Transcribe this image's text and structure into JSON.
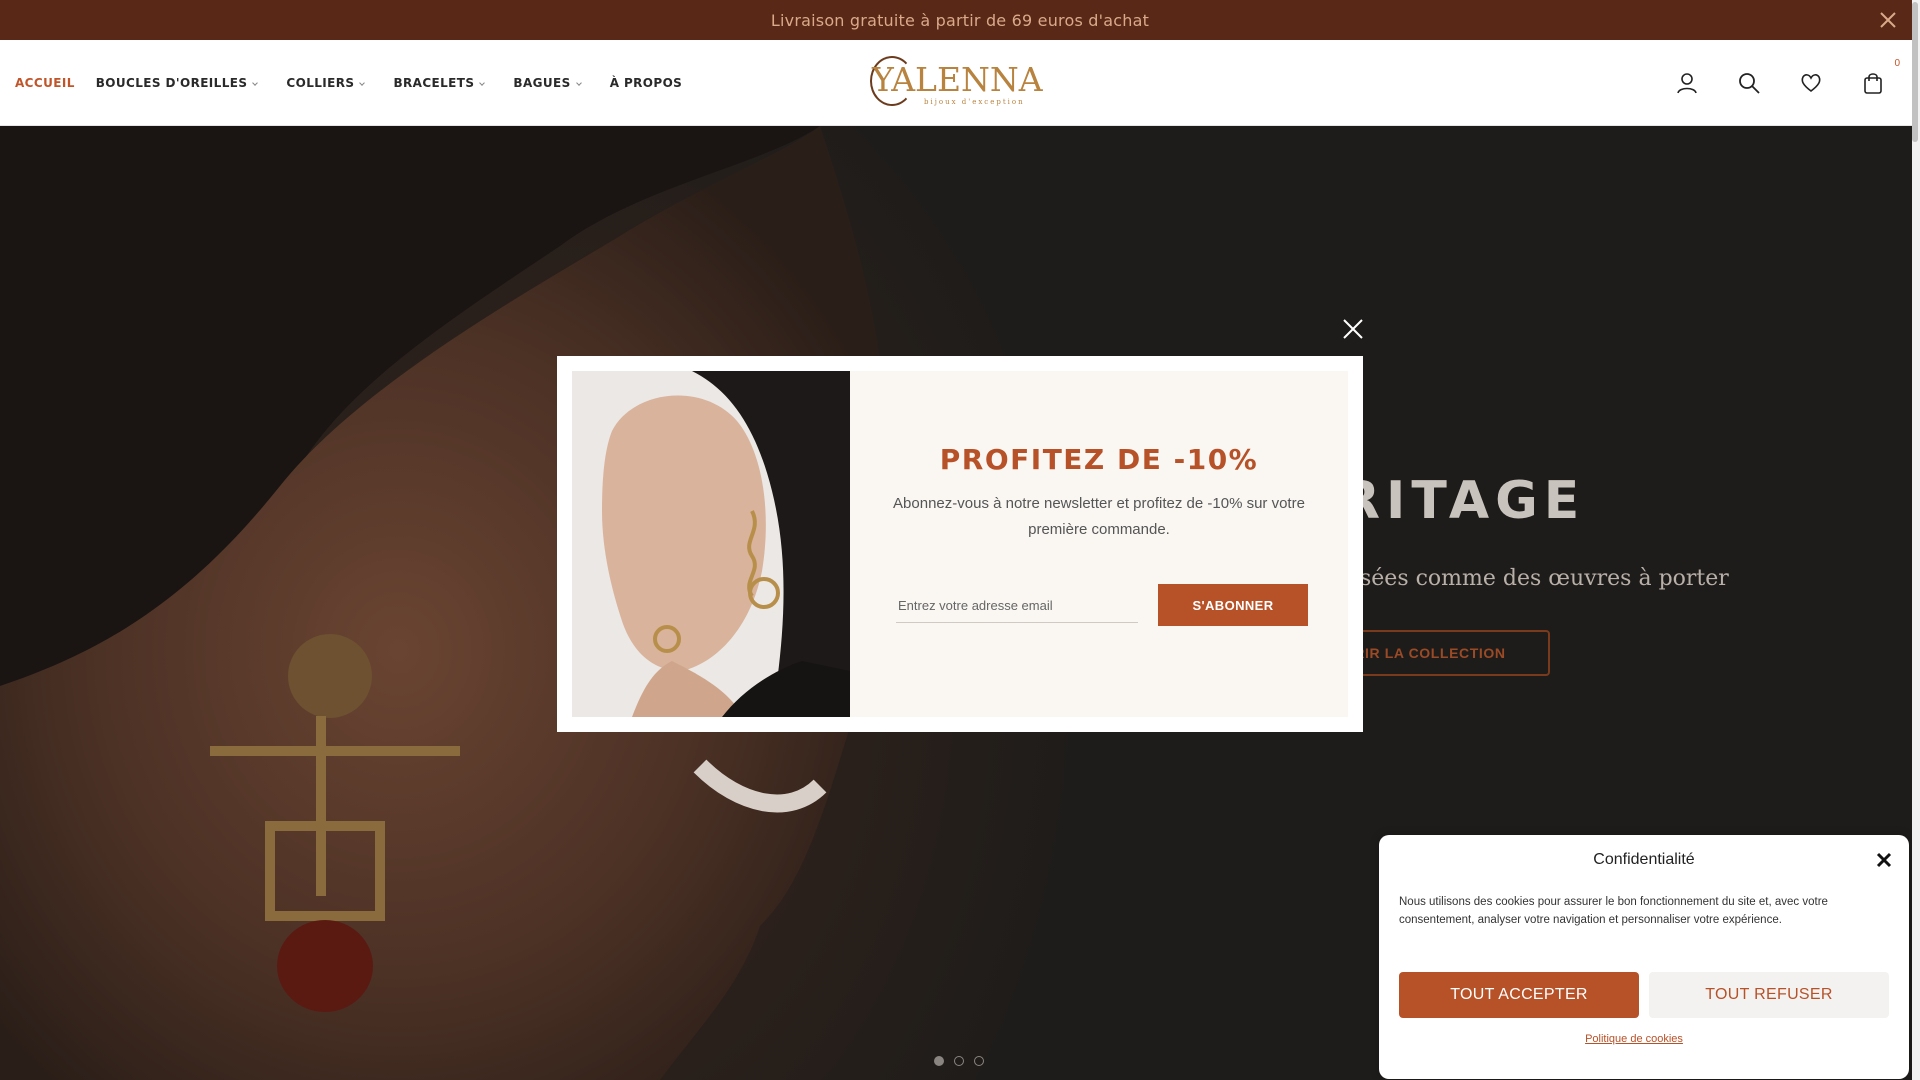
{
  "announcement": {
    "text": "Livraison gratuite à partir de 69 euros d'achat"
  },
  "nav": {
    "items": [
      {
        "label": "ACCUEIL",
        "active": true,
        "dropdown": false
      },
      {
        "label": "BOUCLES D'OREILLES",
        "dropdown": true
      },
      {
        "label": "COLLIERS",
        "dropdown": true
      },
      {
        "label": "BRACELETS",
        "dropdown": true
      },
      {
        "label": "BAGUES",
        "dropdown": true
      },
      {
        "label": "À PROPOS",
        "dropdown": false
      }
    ]
  },
  "brand": {
    "name": "YALENNA",
    "tagline": "bijoux d'exception"
  },
  "header_icons": [
    "account-icon",
    "search-icon",
    "heart-icon",
    "cart-icon"
  ],
  "cart": {
    "count": "0"
  },
  "hero": {
    "title_visible": "RITAGE",
    "subtitle_visible": "sées comme des œuvres à porter",
    "cta_visible": "VRIR LA COLLECTION",
    "slides": 3,
    "active_slide": 1
  },
  "newsletter": {
    "title": "PROFITEZ DE -10%",
    "text": "Abonnez-vous à notre newsletter et profitez de -10% sur votre première commande.",
    "email_placeholder": "Entrez votre adresse email",
    "button": "S'ABONNER"
  },
  "cookie": {
    "title": "Confidentialité",
    "text": "Nous utilisons des cookies pour assurer le bon fonctionnement du site et, avec votre consentement, analyser votre navigation et personnaliser votre expérience.",
    "accept": "TOUT ACCEPTER",
    "refuse": "TOUT REFUSER",
    "policy": "Politique de cookies"
  },
  "colors": {
    "accent": "#b75128",
    "announce_bg": "#5a2816",
    "logo_gold": "#b8823f"
  }
}
